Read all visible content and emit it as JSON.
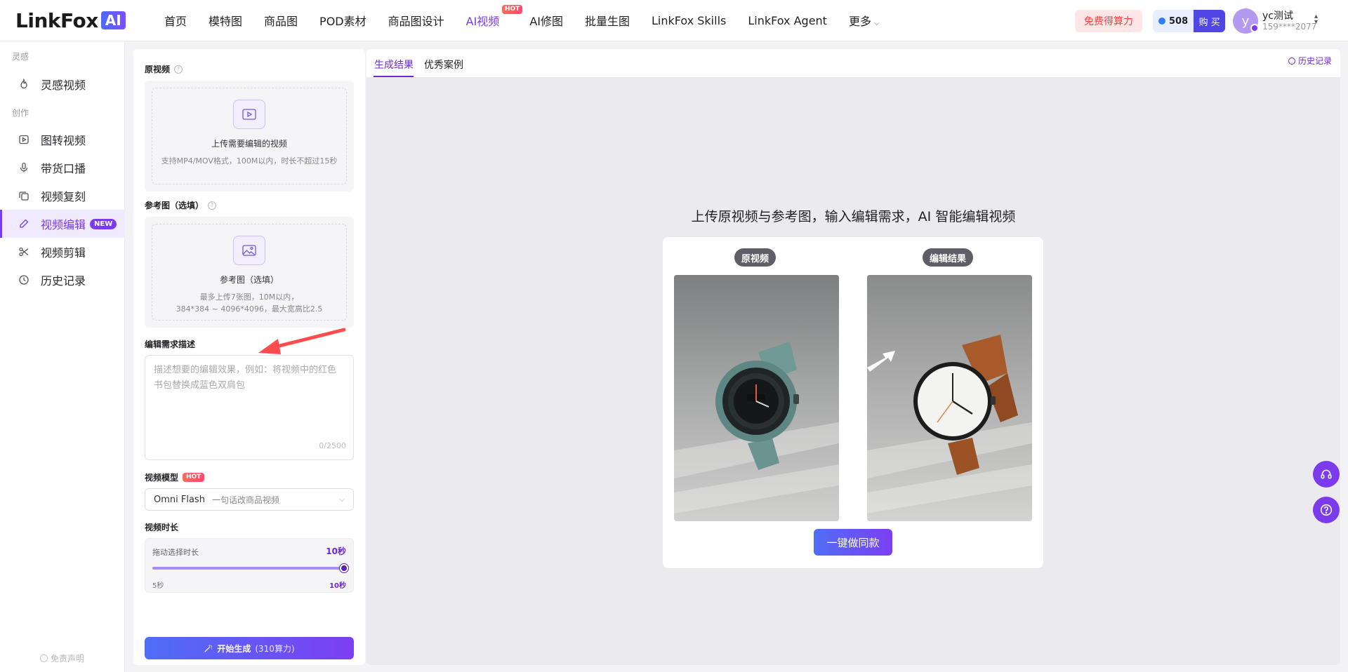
{
  "brand": {
    "name": "LinkFox",
    "badge": "AI"
  },
  "nav": {
    "items": [
      "首页",
      "模特图",
      "商品图",
      "POD素材",
      "商品图设计",
      "AI视频",
      "AI修图",
      "批量生图",
      "LinkFox Skills",
      "LinkFox Agent",
      "更多"
    ],
    "active": "AI视频",
    "hot_badge": "HOT"
  },
  "header": {
    "free_credits": "免费得算力",
    "credits": "508",
    "buy": "购 买",
    "avatar_letter": "y",
    "user_name": "yc测试",
    "user_phone": "159****2077"
  },
  "sidebar": {
    "group_inspiration": "灵感",
    "group_create": "创作",
    "items": [
      {
        "label": "灵感视频",
        "icon": "fire-icon"
      },
      {
        "label": "图转视频",
        "icon": "play-box-icon"
      },
      {
        "label": "带货口播",
        "icon": "microphone-icon"
      },
      {
        "label": "视频复刻",
        "icon": "copy-icon"
      },
      {
        "label": "视频编辑",
        "icon": "pencil-icon",
        "badge": "NEW",
        "active": true
      },
      {
        "label": "视频剪辑",
        "icon": "scissors-icon"
      },
      {
        "label": "历史记录",
        "icon": "clock-icon"
      }
    ],
    "disclaimer": "免责声明"
  },
  "form": {
    "source_video_label": "原视频",
    "source_upload_title": "上传需要编辑的视频",
    "source_upload_desc": "支持MP4/MOV格式，100M以内，时长不超过15秒",
    "ref_label": "参考图（选填）",
    "ref_upload_title": "参考图（选填）",
    "ref_upload_desc1": "最多上传7张图，10M以内，",
    "ref_upload_desc2": "384*384 ~ 4096*4096，最大宽高比2.5",
    "desc_label": "编辑需求描述",
    "desc_placeholder": "描述想要的编辑效果，例如：将视频中的红色书包替换成蓝色双肩包",
    "char_count": "0/2500",
    "model_label": "视频模型",
    "model_badge": "HOT",
    "model_value": "Omni Flash",
    "model_sub": "一句话改商品视频",
    "duration_label": "视频时长",
    "duration_hint": "拖动选择时长",
    "duration_value": "10秒",
    "duration_min": "5秒",
    "duration_max": "10秒",
    "duration_level": 1.0,
    "generate_label": "开始生成",
    "generate_cost": "(310算力)"
  },
  "result": {
    "tabs": [
      "生成结果",
      "优秀案例"
    ],
    "active_tab": "生成结果",
    "history": "历史记录",
    "headline": "上传原视频与参考图，输入编辑需求，AI 智能编辑视频",
    "before_label": "原视频",
    "after_label": "编辑结果",
    "cta": "一键做同款"
  },
  "colors": {
    "accent": "#7c3aed",
    "hot": "#ff4a6e",
    "cta_start": "#4f6ef7",
    "cta_end": "#7b3ff2"
  }
}
